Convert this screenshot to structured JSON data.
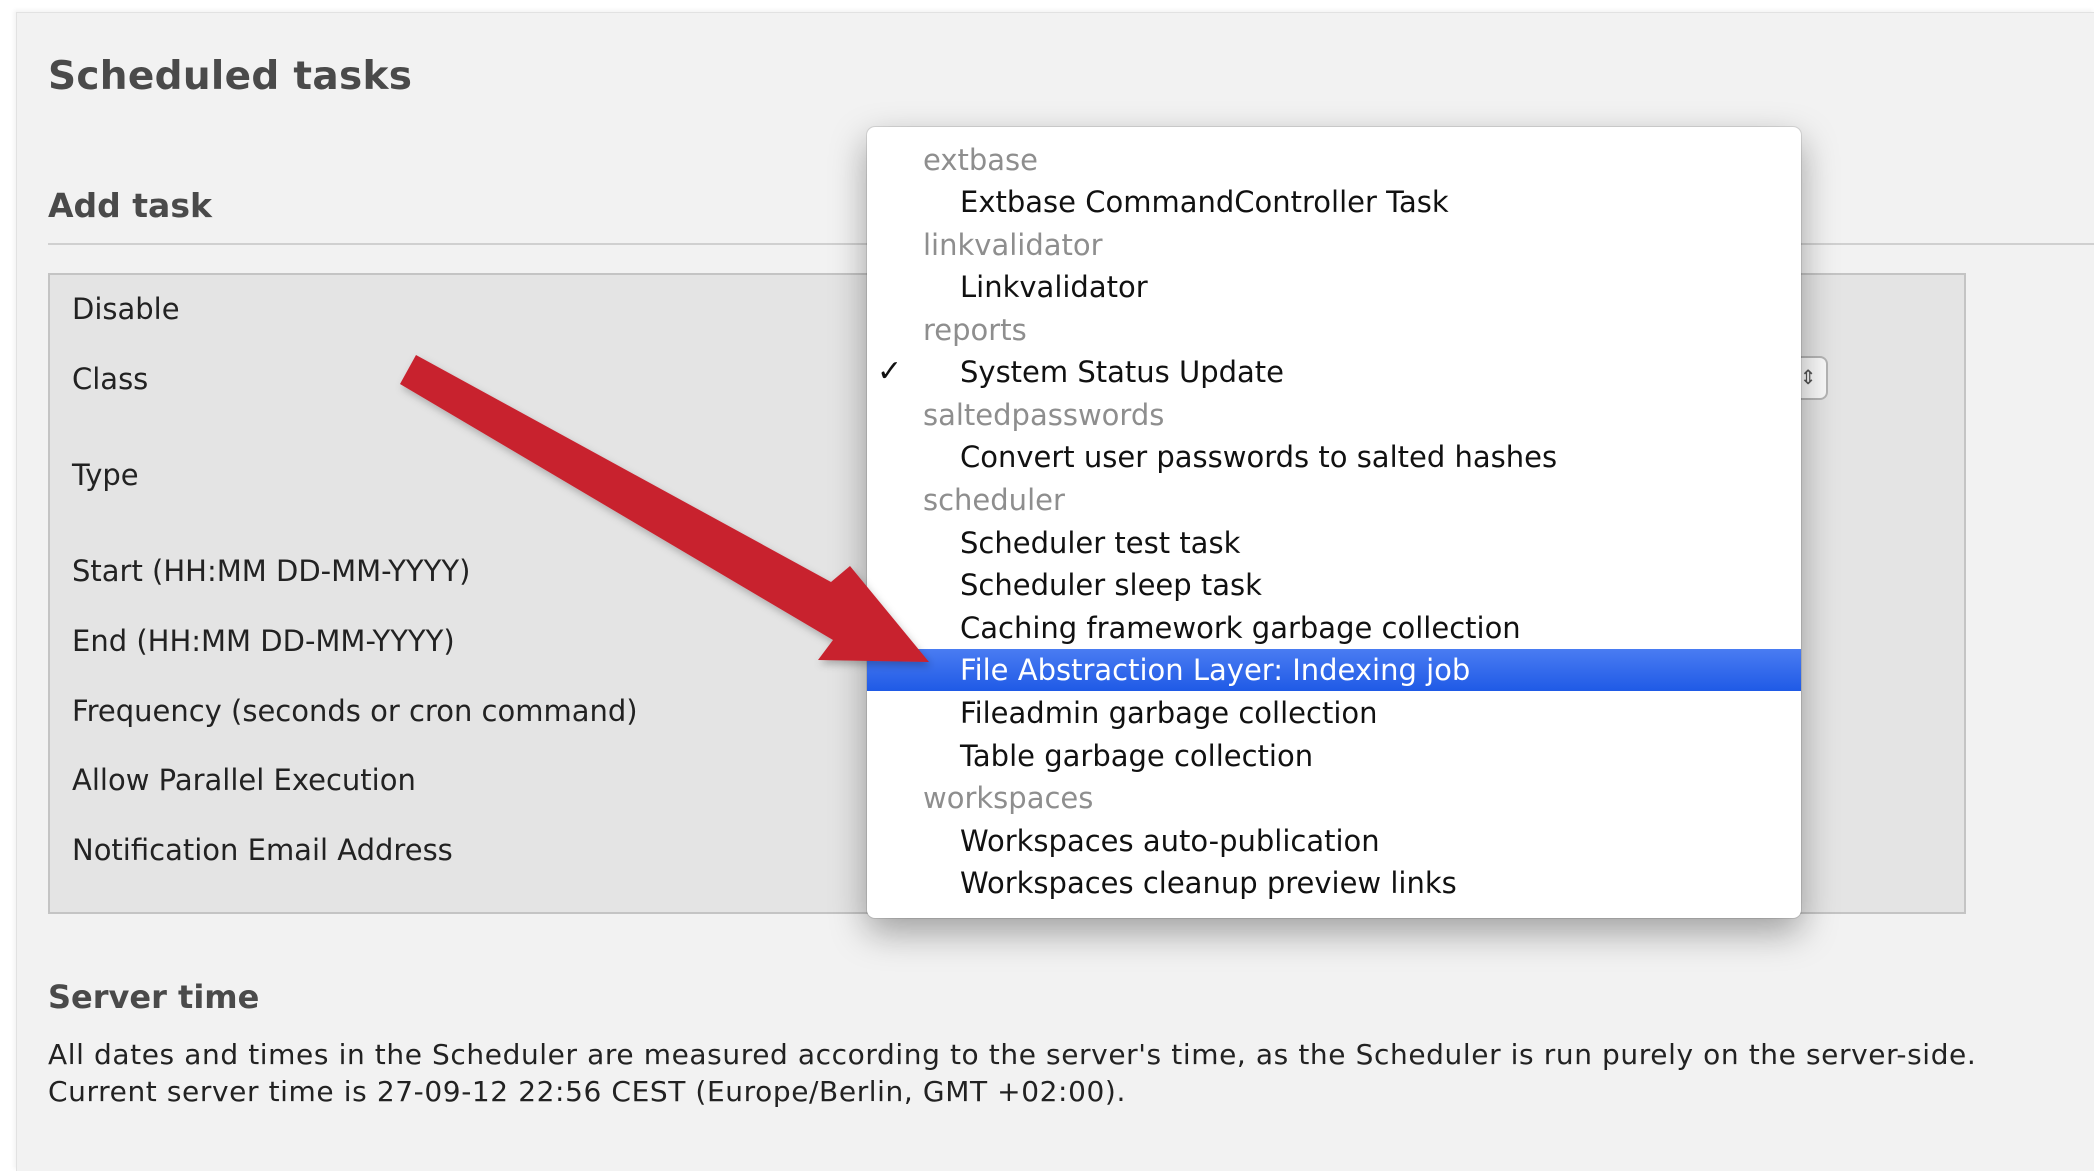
{
  "page": {
    "title": "Scheduled tasks",
    "section_title": "Add task",
    "form_labels": [
      "Disable",
      "Class",
      "Type",
      "Start (HH:MM DD-MM-YYYY)",
      "End (HH:MM DD-MM-YYYY)",
      "Frequency (seconds or cron command)",
      "Allow Parallel Execution",
      "Notification Email Address"
    ],
    "server_time": {
      "title": "Server time",
      "line1": "All dates and times in the Scheduler are measured according to the server's time, as the Scheduler is run purely on the server-side.",
      "line2": "Current server time is 27-09-12 22:56 CEST (Europe/Berlin, GMT +02:00)."
    }
  },
  "class_dropdown": {
    "checked_item": "System Status Update",
    "highlighted_item": "File Abstraction Layer: Indexing job",
    "checkmark": "✓",
    "groups": [
      {
        "label": "extbase",
        "items": [
          "Extbase CommandController Task"
        ]
      },
      {
        "label": "linkvalidator",
        "items": [
          "Linkvalidator"
        ]
      },
      {
        "label": "reports",
        "items": [
          "System Status Update"
        ]
      },
      {
        "label": "saltedpasswords",
        "items": [
          "Convert user passwords to salted hashes"
        ]
      },
      {
        "label": "scheduler",
        "items": [
          "Scheduler test task",
          "Scheduler sleep task",
          "Caching framework garbage collection",
          "File Abstraction Layer: Indexing job",
          "Fileadmin garbage collection",
          "Table garbage collection"
        ]
      },
      {
        "label": "workspaces",
        "items": [
          "Workspaces auto-publication",
          "Workspaces cleanup preview links"
        ]
      }
    ]
  },
  "colors": {
    "highlight": "#2a63ea",
    "annotation_arrow": "#c8202f",
    "panel_background": "#f2f2f2"
  },
  "icons": {
    "select_stepper": "updown-arrows-icon",
    "annotation": "red-arrow-icon"
  }
}
